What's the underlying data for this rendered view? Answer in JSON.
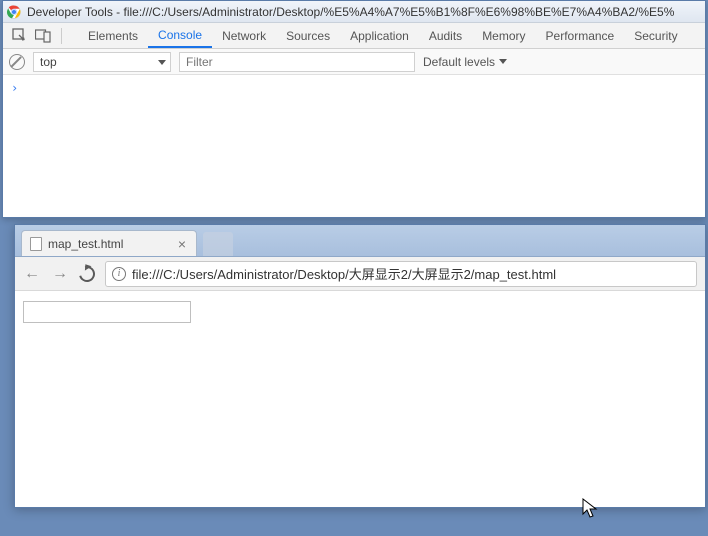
{
  "devtools": {
    "title": "Developer Tools - file:///C:/Users/Administrator/Desktop/%E5%A4%A7%E5%B1%8F%E6%98%BE%E7%A4%BA2/%E5%",
    "tabs": [
      "Elements",
      "Console",
      "Network",
      "Sources",
      "Application",
      "Audits",
      "Memory",
      "Performance",
      "Security"
    ],
    "active_tab": "Console",
    "context_selector": "top",
    "filter_placeholder": "Filter",
    "levels_label": "Default levels",
    "prompt": "›"
  },
  "browser": {
    "tab_title": "map_test.html",
    "url": "file:///C:/Users/Administrator/Desktop/大屏显示2/大屏显示2/map_test.html"
  }
}
